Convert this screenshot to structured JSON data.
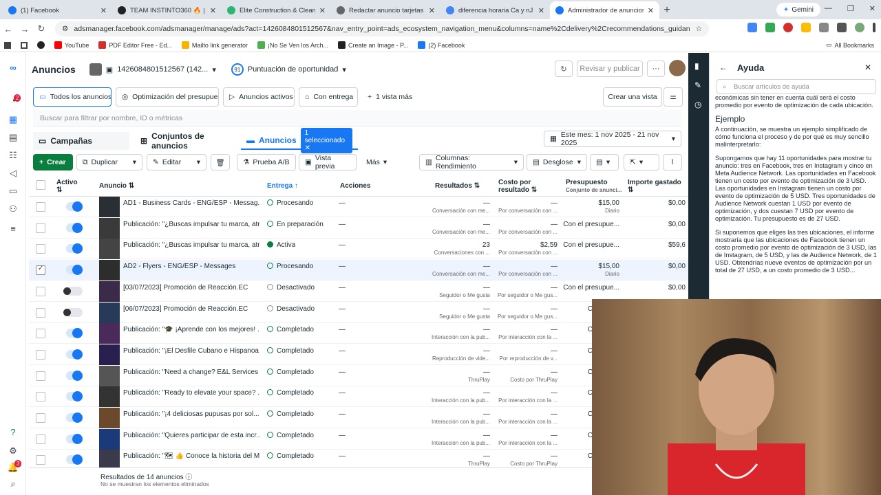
{
  "browser": {
    "tabs": [
      {
        "title": "(1) Facebook",
        "color": "#1877f2"
      },
      {
        "title": "TEAM INSTINTO360 🔥 | Trello",
        "color": "#222"
      },
      {
        "title": "Elite Construction & Cleaning |",
        "color": "#2bb673"
      },
      {
        "title": "Redactar anuncio tarjetas",
        "color": "#666"
      },
      {
        "title": "diferencia horaria Ca y nJ - Bus",
        "color": "#4285f4"
      },
      {
        "title": "Administrador de anuncios - Ad",
        "color": "#1877f2"
      }
    ],
    "gemini": "Gemini",
    "url": "adsmanager.facebook.com/adsmanager/manage/ads?act=1426084801512567&nav_entry_point=ads_ecosystem_navigation_menu&columns=name%2Cdelivery%2Crecommendations_guidance%2Cresults%2Ccost_pe...",
    "bookmarks": [
      {
        "label": "YouTube",
        "color": "#ff0000"
      },
      {
        "label": "PDF Editor Free - Ed...",
        "color": "#d32f2f"
      },
      {
        "label": "Mailto link generator",
        "color": "#f4b400"
      },
      {
        "label": "¡No Se Ven los Arch...",
        "color": "#4caf50"
      },
      {
        "label": "Create an Image - P...",
        "color": "#222"
      },
      {
        "label": "(2) Facebook",
        "color": "#1877f2"
      }
    ],
    "all_bookmarks": "All Bookmarks"
  },
  "header": {
    "title": "Anuncios",
    "account": "1426084801512567 (142...",
    "opportunity_score": "91",
    "opportunity_label": "Puntuación de oportunidad",
    "review_publish": "Revisar y publicar",
    "more": "···"
  },
  "views": {
    "tabs": [
      "Todos los anuncios",
      "Optimización del presupuesto",
      "Anuncios activos",
      "Con entrega"
    ],
    "more": "1 vista más",
    "create_view": "Crear una vista"
  },
  "search_placeholder": "Buscar para filtrar por nombre, ID o métricas",
  "levels": {
    "campaigns": "Campañas",
    "adsets": "Conjuntos de anuncios",
    "ads": "Anuncios",
    "selected": "1 seleccionado"
  },
  "date_range": "Este mes: 1 nov 2025 - 21 nov 2025",
  "toolbar": {
    "create": "Crear",
    "duplicate": "Duplicar",
    "edit": "Editar",
    "ab": "Prueba A/B",
    "preview": "Vista previa",
    "more": "Más",
    "columns": "Columnas: Rendimiento",
    "breakdown": "Desglose"
  },
  "columns": {
    "active": "Activo",
    "ad": "Anuncio",
    "delivery": "Entrega",
    "actions": "Acciones",
    "results": "Resultados",
    "cost": "Costo por resultado",
    "budget": "Presupuesto",
    "budget_sub": "Conjunto de anunci...",
    "spent": "Importe gastado"
  },
  "rows": [
    {
      "on": true,
      "checked": false,
      "name": "AD1 - Business Cards - ENG/ESP - Messag...",
      "delivery": "Procesando",
      "dot": "ring",
      "actions": "—",
      "results": "—",
      "results_sub": "Conversación con me...",
      "cost": "—",
      "cost_sub": "Por conversación con ...",
      "budget": "$15,00",
      "budget_sub": "Diario",
      "spent": "$0,00"
    },
    {
      "on": true,
      "checked": false,
      "name": "Publicación: \"¿Buscas impulsar tu marca, atr...",
      "delivery": "En preparación",
      "dot": "ring",
      "actions": "—",
      "results": "—",
      "results_sub": "Conversación con me...",
      "cost": "—",
      "cost_sub": "Por conversación con ...",
      "budget": "Con el presupue...",
      "budget_sub": "",
      "spent": "$0,00"
    },
    {
      "on": true,
      "checked": false,
      "name": "Publicación: \"¿Buscas impulsar tu marca, atr...",
      "delivery": "Activa",
      "dot": "fill",
      "actions": "—",
      "results": "23",
      "results_sub": "Conversaciones con ...",
      "cost": "$2,59",
      "cost_sub": "Por conversación con ...",
      "budget": "Con el presupue...",
      "budget_sub": "",
      "spent": "$59,6"
    },
    {
      "on": true,
      "checked": true,
      "name": "AD2 - Flyers - ENG/ESP - Messages",
      "delivery": "Procesando",
      "dot": "ring",
      "actions": "—",
      "results": "—",
      "results_sub": "Conversación con me...",
      "cost": "—",
      "cost_sub": "Por conversación con ...",
      "budget": "$15,00",
      "budget_sub": "Diario",
      "spent": "$0,00"
    },
    {
      "on": false,
      "checked": false,
      "name": "[03/07/2023] Promoción de Reacción.EC",
      "delivery": "Desactivado",
      "dot": "gray",
      "actions": "—",
      "results": "—",
      "results_sub": "Seguidor o Me gusta",
      "cost": "—",
      "cost_sub": "Por seguidor o Me gus...",
      "budget": "Con el presupue...",
      "budget_sub": "",
      "spent": "$0,00"
    },
    {
      "on": false,
      "checked": false,
      "name": "[06/07/2023] Promoción de Reacción.EC",
      "delivery": "Desactivado",
      "dot": "gray",
      "actions": "—",
      "results": "—",
      "results_sub": "Seguidor o Me gusta",
      "cost": "—",
      "cost_sub": "Por seguidor o Me gus...",
      "budget": "Con el pre",
      "budget_sub": "",
      "spent": ""
    },
    {
      "on": true,
      "checked": false,
      "name": "Publicación: \"🎓 ¡Aprende con los mejores! ...",
      "delivery": "Completado",
      "dot": "ring",
      "actions": "—",
      "results": "—",
      "results_sub": "Interacción con la pub...",
      "cost": "—",
      "cost_sub": "Por interacción con la ...",
      "budget": "Con el pre",
      "budget_sub": "",
      "spent": ""
    },
    {
      "on": true,
      "checked": false,
      "name": "Publicación: \"¡El Desfile Cubano e Hispanoa...",
      "delivery": "Completado",
      "dot": "ring",
      "actions": "—",
      "results": "—",
      "results_sub": "Reproducción de vide...",
      "cost": "—",
      "cost_sub": "Por reproducción de v...",
      "budget": "Con el pre",
      "budget_sub": "",
      "spent": ""
    },
    {
      "on": true,
      "checked": false,
      "name": "Publicación: \"Need a change? E&L Services ...",
      "delivery": "Completado",
      "dot": "ring",
      "actions": "—",
      "results": "—",
      "results_sub": "ThruPlay",
      "cost": "—",
      "cost_sub": "Costo por ThruPlay",
      "budget": "Con el pre",
      "budget_sub": "",
      "spent": ""
    },
    {
      "on": true,
      "checked": false,
      "name": "Publicación: \"Ready to elevate your space? ...",
      "delivery": "Completado",
      "dot": "ring",
      "actions": "—",
      "results": "—",
      "results_sub": "Interacción con la pub...",
      "cost": "—",
      "cost_sub": "Por interacción con la ...",
      "budget": "Con el pre",
      "budget_sub": "",
      "spent": ""
    },
    {
      "on": true,
      "checked": false,
      "name": "Publicación: \"¡4 deliciosas pupusas por sol...",
      "delivery": "Completado",
      "dot": "ring",
      "actions": "—",
      "results": "—",
      "results_sub": "Interacción con la pub...",
      "cost": "—",
      "cost_sub": "Por interacción con la ...",
      "budget": "Con el pre",
      "budget_sub": "",
      "spent": ""
    },
    {
      "on": true,
      "checked": false,
      "name": "Publicación: \"Quieres participar de esta incr...",
      "delivery": "Completado",
      "dot": "ring",
      "actions": "—",
      "results": "—",
      "results_sub": "Interacción con la pub...",
      "cost": "—",
      "cost_sub": "Por interacción con la ...",
      "budget": "Con el pre",
      "budget_sub": "",
      "spent": ""
    },
    {
      "on": true,
      "checked": false,
      "name": "Publicación: \"🗺 👍 Conoce la historia del M...",
      "delivery": "Completado",
      "dot": "ring",
      "actions": "—",
      "results": "—",
      "results_sub": "ThruPlay",
      "cost": "—",
      "cost_sub": "Costo por ThruPlay",
      "budget": "Con el pre",
      "budget_sub": "",
      "spent": ""
    }
  ],
  "footer": {
    "results": "Resultados de 14 anuncios",
    "note": "No se muestran los elementos eliminados"
  },
  "help": {
    "title": "Ayuda",
    "search_placeholder": "Buscar artículos de ayuda",
    "p0": "económicas sin tener en cuenta cuál será el costo promedio por evento de optimización de cada ubicación.",
    "h": "Ejemplo",
    "p1": "A continuación, se muestra un ejemplo simplificado de cómo funciona el proceso y de por qué es muy sencillo malinterpretarlo:",
    "p2": "Supongamos que hay 11 oportunidades para mostrar tu anuncio: tres en Facebook, tres en Instagram y cinco en Meta Audience Network. Las oportunidades en Facebook tienen un costo por evento de optimización de 3 USD. Las oportunidades en Instagram tienen un costo por evento de optimización de 5 USD. Tres oportunidades de Audience Network cuestan 1 USD por evento de optimización, y dos cuestan 7 USD por evento de optimización. Tu presupuesto es de 27 USD.",
    "p3": "Si suponemos que eliges las tres ubicaciones, el informe mostraría que las ubicaciones de Facebook tienen un costo promedio por evento de optimización de 3 USD, las de Instagram, de 5 USD, y las de Audience Network, de 1 USD. Obtendrías nueve eventos de optimización por un total de 27 USD, a un costo promedio de 3 USD..."
  },
  "nav_badges": {
    "notif": "2",
    "alerts": "3"
  }
}
